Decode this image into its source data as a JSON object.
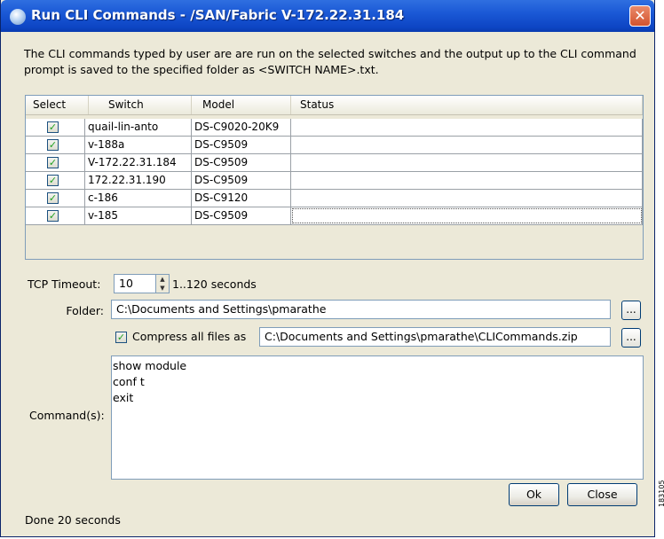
{
  "window": {
    "title": "Run CLI Commands - /SAN/Fabric V-172.22.31.184",
    "close_glyph": "✕"
  },
  "description": "The CLI commands typed by user are are run on the selected switches and the output up to the CLI command prompt is saved to the specified folder as <SWITCH NAME>.txt.",
  "table": {
    "headers": [
      "Select",
      "Switch",
      "Model",
      "Status"
    ],
    "rows": [
      {
        "selected": true,
        "switch": "quail-lin-anto",
        "model": "DS-C9020-20K9",
        "status": ""
      },
      {
        "selected": true,
        "switch": "v-188a",
        "model": "DS-C9509",
        "status": ""
      },
      {
        "selected": true,
        "switch": "V-172.22.31.184",
        "model": "DS-C9509",
        "status": ""
      },
      {
        "selected": true,
        "switch": "172.22.31.190",
        "model": "DS-C9509",
        "status": ""
      },
      {
        "selected": true,
        "switch": "c-186",
        "model": "DS-C9120",
        "status": ""
      },
      {
        "selected": true,
        "switch": "v-185",
        "model": "DS-C9509",
        "status": ""
      }
    ]
  },
  "tcp": {
    "label": "TCP Timeout:",
    "value": "10",
    "range": "1..120 seconds"
  },
  "folder": {
    "label": "Folder:",
    "value": "C:\\Documents and Settings\\pmarathe",
    "browse": "..."
  },
  "compress": {
    "checked": true,
    "label": "Compress all files as",
    "value": "C:\\Documents and Settings\\pmarathe\\CLICommands.zip",
    "browse": "..."
  },
  "commands": {
    "label": "Command(s):",
    "lines": [
      "show module",
      "conf t",
      "exit"
    ]
  },
  "buttons": {
    "ok": "Ok",
    "close": "Close"
  },
  "status": "Done 20 seconds",
  "side_mark": "183105",
  "icons": {
    "check": "✓",
    "spin_up": "▲",
    "spin_down": "▼"
  }
}
